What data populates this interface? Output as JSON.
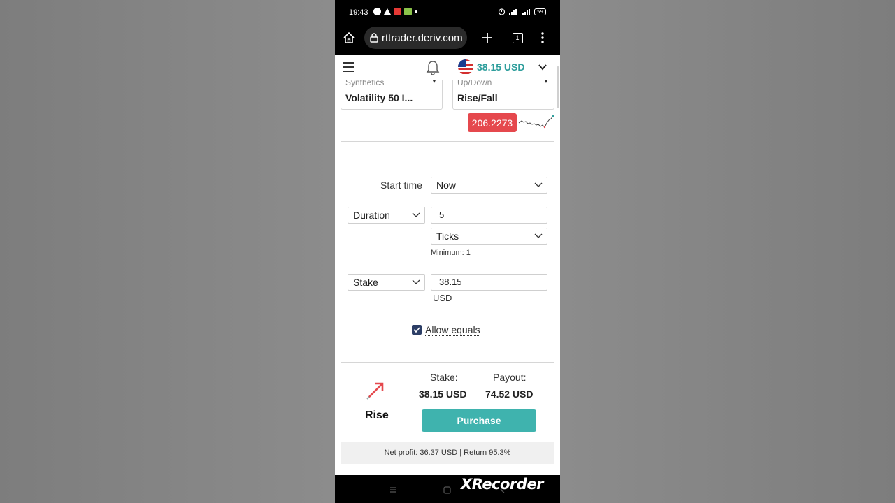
{
  "status_bar": {
    "time": "19:43",
    "battery": "59"
  },
  "browser": {
    "url": "rttrader.deriv.com",
    "tab_count": "1"
  },
  "header": {
    "balance": "38.15 USD"
  },
  "market_selector": {
    "category": "Synthetics",
    "value": "Volatility 50 I..."
  },
  "trade_type_selector": {
    "category": "Up/Down",
    "value": "Rise/Fall"
  },
  "spot": {
    "price": "206.2273",
    "color": "#e5484d"
  },
  "form": {
    "start_time_label": "Start time",
    "start_time_value": "Now",
    "duration_type": "Duration",
    "duration_value": "5",
    "duration_unit": "Ticks",
    "duration_hint": "Minimum: 1",
    "amount_type": "Stake",
    "amount_value": "38.15",
    "currency": "USD",
    "allow_equals_label": "Allow equals",
    "allow_equals_checked": true
  },
  "purchase": {
    "contract_label": "Rise",
    "stake_label": "Stake:",
    "stake_value": "38.15 USD",
    "payout_label": "Payout:",
    "payout_value": "74.52 USD",
    "button_label": "Purchase",
    "net_profit_text": "Net profit: 36.37 USD | Return 95.3%",
    "accent": "#3fb3ae"
  },
  "watermark": "XRecorder"
}
